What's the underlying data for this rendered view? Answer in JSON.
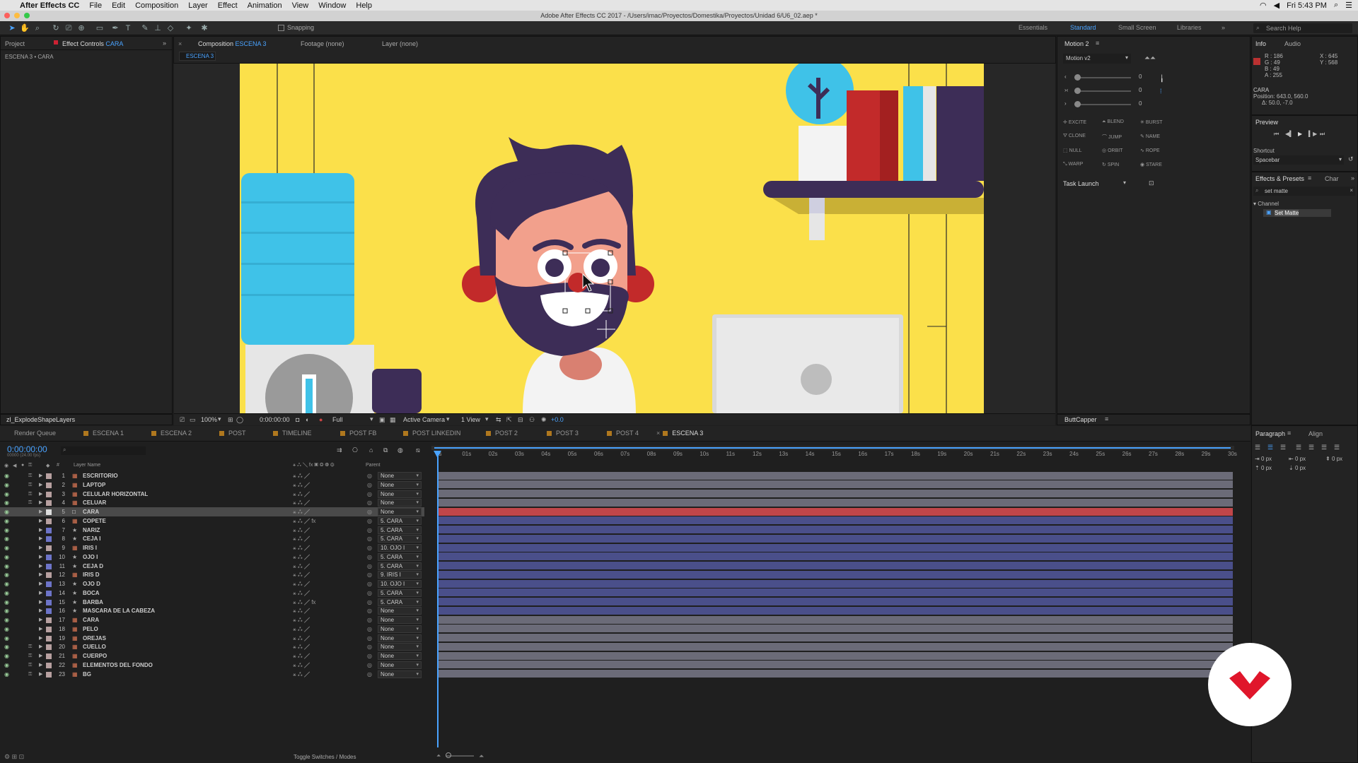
{
  "menubar": {
    "app": "After Effects CC",
    "items": [
      "File",
      "Edit",
      "Composition",
      "Layer",
      "Effect",
      "Animation",
      "View",
      "Window",
      "Help"
    ],
    "clock": "Fri 5:43 PM"
  },
  "window_title": "Adobe After Effects CC 2017 - /Users/imac/Proyectos/Domestika/Proyectos/Unidad 6/U6_02.aep *",
  "toolbar": {
    "snapping": "Snapping",
    "workspaces": [
      "Essentials",
      "Standard",
      "Small Screen",
      "Libraries"
    ],
    "search_placeholder": "Search Help"
  },
  "left_panel": {
    "tab_project": "Project",
    "tab_effect_controls": "Effect Controls",
    "effect_controls_layer": "CARA",
    "breadcrumb": "ESCENA 3 • CARA",
    "bottom_tab": "zl_ExplodeShapeLayers"
  },
  "comp_panel": {
    "tab_comp": "Composition",
    "comp_name": "ESCENA 3",
    "tab_footage": "Footage (none)",
    "tab_layer": "Layer (none)",
    "sub_tab": "ESCENA 3",
    "zoom": "100%",
    "timecode": "0:00:00:00",
    "resolution": "Full",
    "camera": "Active Camera",
    "view": "1 View",
    "exposure": "+0.0"
  },
  "motion_panel": {
    "title": "Motion 2",
    "preset": "Motion v2",
    "values": [
      "0",
      "0",
      "0"
    ],
    "buttons": [
      "EXCITE",
      "BLEND",
      "BURST",
      "CLONE",
      "JUMP",
      "NAME",
      "NULL",
      "ORBIT",
      "ROPE",
      "WARP",
      "SPIN",
      "STARE"
    ],
    "task_launch": "Task Launch",
    "bottom_tab": "ButtCapper"
  },
  "info_panel": {
    "tab_info": "Info",
    "tab_audio": "Audio",
    "r": "R : 186",
    "g": "G : 49",
    "b": "B : 49",
    "a": "A : 255",
    "x": "X : 645",
    "y": "Y : 568",
    "layer": "CARA",
    "position": "Position: 643.0, 560.0",
    "delta": "Δ: 50.0, -7.0",
    "swatch_color": "#ba3131"
  },
  "preview_panel": {
    "title": "Preview",
    "shortcut_label": "Shortcut",
    "shortcut_value": "Spacebar"
  },
  "effects_panel": {
    "tab": "Effects & Presets",
    "tab_char": "Char",
    "search": "set matte",
    "category": "Channel",
    "result": "Set Matte"
  },
  "paragraph_panel": {
    "tab": "Paragraph",
    "tab_align": "Align",
    "values": [
      "0 px",
      "0 px",
      "0 px",
      "0 px",
      "0 px"
    ]
  },
  "timeline": {
    "tabs": [
      "Render Queue",
      "ESCENA 1",
      "ESCENA 2",
      "POST",
      "TIMELINE",
      "POST FB",
      "POST LINKEDIN",
      "POST 2",
      "POST 3",
      "POST 4",
      "ESCENA 3"
    ],
    "tab_colors": [
      "",
      "#b0781e",
      "#b0781e",
      "#b0781e",
      "#b0781e",
      "#b0781e",
      "#b0781e",
      "#b0781e",
      "#b0781e",
      "#b0781e",
      "#b0781e"
    ],
    "timecode": "0:00:00:00",
    "fps": "00000 (24.00 fps)",
    "col_layer_name": "Layer Name",
    "col_parent": "Parent",
    "ticks": [
      "0s",
      "01s",
      "02s",
      "03s",
      "04s",
      "05s",
      "06s",
      "07s",
      "08s",
      "09s",
      "10s",
      "11s",
      "12s",
      "13s",
      "14s",
      "15s",
      "16s",
      "17s",
      "18s",
      "19s",
      "20s",
      "21s",
      "22s",
      "23s",
      "24s",
      "25s",
      "26s",
      "27s",
      "28s",
      "29s",
      "30s"
    ],
    "toggle_label": "Toggle Switches / Modes",
    "layers": [
      {
        "num": "1",
        "name": "ESCRITORIO",
        "parent": "None",
        "type": "comp"
      },
      {
        "num": "2",
        "name": "LAPTOP",
        "parent": "None",
        "type": "comp"
      },
      {
        "num": "3",
        "name": "CELULAR HORIZONTAL",
        "parent": "None",
        "type": "comp"
      },
      {
        "num": "4",
        "name": "CELUAR",
        "parent": "None",
        "type": "comp"
      },
      {
        "num": "5",
        "name": "CARA",
        "parent": "None",
        "type": "null"
      },
      {
        "num": "6",
        "name": "COPETE",
        "parent": "5. CARA",
        "type": "comp"
      },
      {
        "num": "7",
        "name": "NARIZ",
        "parent": "5. CARA",
        "type": "shape"
      },
      {
        "num": "8",
        "name": "CEJA I",
        "parent": "5. CARA",
        "type": "shape"
      },
      {
        "num": "9",
        "name": "IRIS I",
        "parent": "10. OJO I",
        "type": "comp"
      },
      {
        "num": "10",
        "name": "OJO I",
        "parent": "5. CARA",
        "type": "shape"
      },
      {
        "num": "11",
        "name": "CEJA D",
        "parent": "5. CARA",
        "type": "shape"
      },
      {
        "num": "12",
        "name": "IRIS D",
        "parent": "9. IRIS I",
        "type": "comp"
      },
      {
        "num": "13",
        "name": "OJO D",
        "parent": "10. OJO I",
        "type": "shape"
      },
      {
        "num": "14",
        "name": "BOCA",
        "parent": "5. CARA",
        "type": "shape"
      },
      {
        "num": "15",
        "name": "BARBA",
        "parent": "5. CARA",
        "type": "shape"
      },
      {
        "num": "16",
        "name": "MASCARA DE LA CABEZA",
        "parent": "None",
        "type": "shape"
      },
      {
        "num": "17",
        "name": "CARA",
        "parent": "None",
        "type": "comp"
      },
      {
        "num": "18",
        "name": "PELO",
        "parent": "None",
        "type": "comp"
      },
      {
        "num": "19",
        "name": "OREJAS",
        "parent": "None",
        "type": "comp"
      },
      {
        "num": "20",
        "name": "CUELLO",
        "parent": "None",
        "type": "comp"
      },
      {
        "num": "21",
        "name": "CUERPO",
        "parent": "None",
        "type": "comp"
      },
      {
        "num": "22",
        "name": "ELEMENTOS DEL FONDO",
        "parent": "None",
        "type": "comp"
      },
      {
        "num": "23",
        "name": "BG",
        "parent": "None",
        "type": "comp"
      }
    ]
  },
  "colors": {
    "accent": "#4aa3ff",
    "canvas_bg": "#fbe04a",
    "selected_bar": "#c0464a",
    "blue_bar": "#4a4f8a",
    "gray_bar": "#6b6b78",
    "brand": "#e0162b"
  }
}
